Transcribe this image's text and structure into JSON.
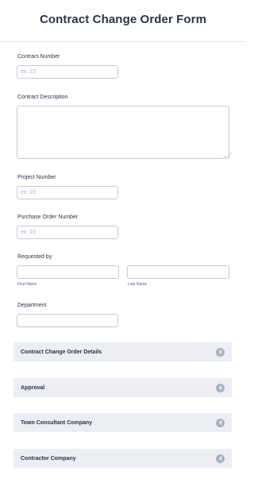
{
  "form": {
    "title": "Contract Change Order Form"
  },
  "fields": {
    "contract_number": {
      "label": "Contract Number",
      "placeholder": "ex: 23"
    },
    "contract_description": {
      "label": "Contract Description",
      "value": ""
    },
    "project_number": {
      "label": "Project Number",
      "placeholder": "ex: 23"
    },
    "purchase_order_number": {
      "label": "Purchase Order Number",
      "placeholder": "ex: 23"
    },
    "requested_by": {
      "label": "Requested by",
      "first_name_sublabel": "First Name",
      "last_name_sublabel": "Last Name"
    },
    "department": {
      "label": "Department",
      "value": ""
    }
  },
  "sections": [
    {
      "title": "Contract Change Order Details",
      "icon": "chevron-left-icon"
    },
    {
      "title": "Approval",
      "icon": "chevron-left-icon"
    },
    {
      "title": "Town Consultant Company",
      "icon": "chevron-left-icon"
    },
    {
      "title": "Contractor Company",
      "icon": "chevron-left-icon"
    }
  ],
  "colors": {
    "section_background": "#eceef4",
    "collapse_button": "#aab1bf",
    "input_border": "#c3cad8",
    "text": "#2c3345"
  }
}
